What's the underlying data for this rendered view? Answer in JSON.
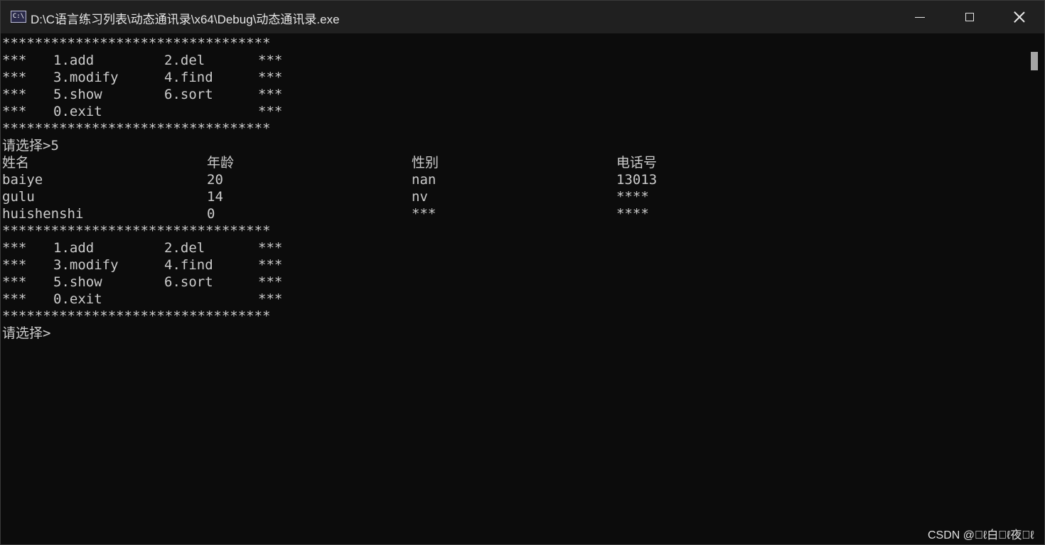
{
  "window": {
    "title": "D:\\C语言练习列表\\动态通讯录\\x64\\Debug\\动态通讯录.exe",
    "icon_label": "C:\\",
    "controls": {
      "minimize": "minimize-icon",
      "maximize": "maximize-icon",
      "close": "close-icon"
    }
  },
  "console": {
    "stars": "*********************************",
    "menu": [
      {
        "l": "***",
        "a": "1.add",
        "b": "2.del",
        "r": "***"
      },
      {
        "l": "***",
        "a": "3.modify",
        "b": "4.find",
        "r": "***"
      },
      {
        "l": "***",
        "a": "5.show",
        "b": "6.sort",
        "r": "***"
      },
      {
        "l": "***",
        "a": "0.exit",
        "b": "",
        "r": "***"
      }
    ],
    "prompt_with_input": "请选择>5",
    "prompt_empty": "请选择>",
    "table": {
      "headers": [
        "姓名",
        "年龄",
        "性别",
        "电话号"
      ],
      "rows": [
        [
          "baiye",
          "20",
          "nan",
          "13013"
        ],
        [
          "gulu",
          "14",
          "nv",
          "****"
        ],
        [
          "huishenshi",
          "0",
          "***",
          "****"
        ]
      ]
    }
  },
  "watermark": "CSDN @\u0000ℓ白\u0000ℓ夜\u0000ℓ",
  "colors": {
    "background": "#0c0c0c",
    "titlebar": "#202020",
    "text": "#cccccc"
  }
}
